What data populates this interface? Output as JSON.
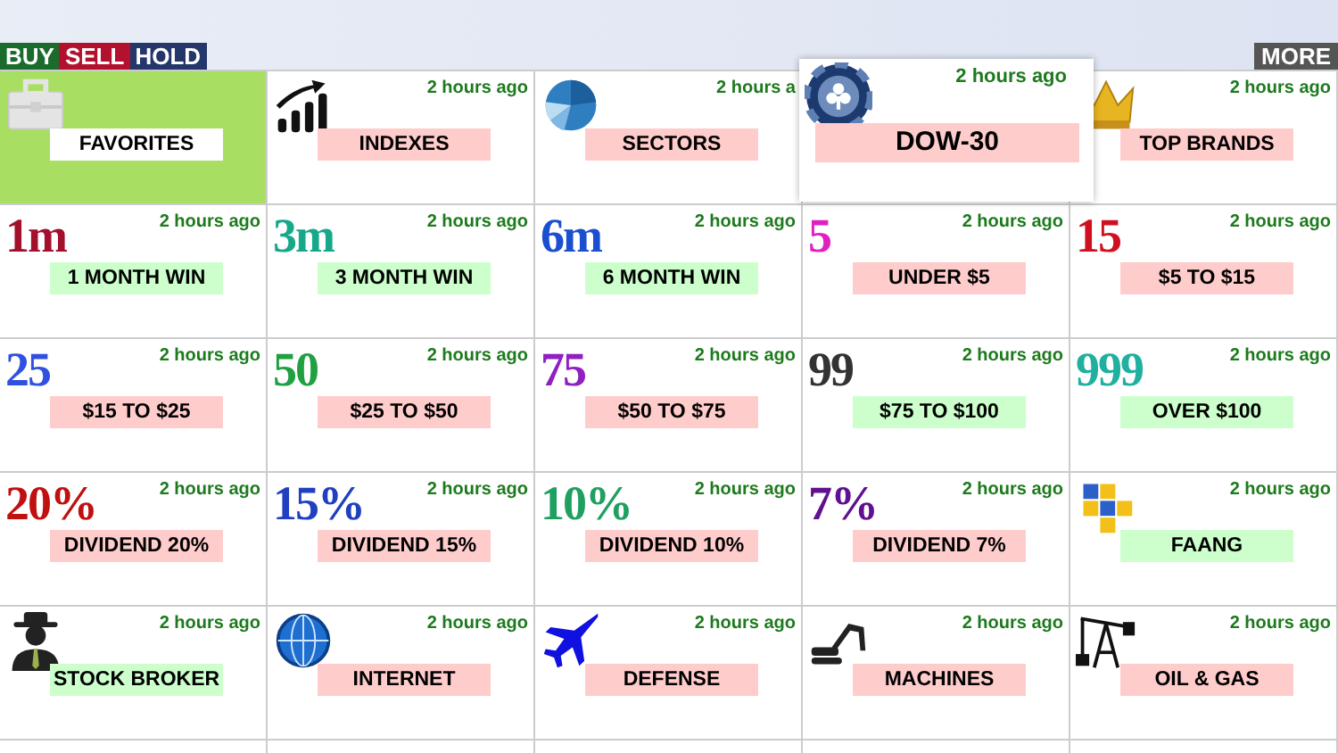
{
  "logo": [
    {
      "text": "BUY",
      "color": "#1b6b2c"
    },
    {
      "text": "SELL",
      "color": "#b3122e"
    },
    {
      "text": "HOLD",
      "color": "#24366a"
    }
  ],
  "more_button": "MORE",
  "tiles": [
    {
      "label": "FAVORITES",
      "kind": "briefcase",
      "color": "#ffffff",
      "selected": true,
      "raised": false
    },
    {
      "label": "INDEXES",
      "time": "2 hours ago",
      "kind": "growth-chart",
      "color": "#ffcccc",
      "selected": false,
      "raised": false
    },
    {
      "label": "SECTORS",
      "time": "2 hours a",
      "kind": "pie-chart",
      "color": "#ffcccc",
      "selected": false,
      "raised": false
    },
    {
      "label": "DOW-30",
      "time": "2 hours ago",
      "kind": "chip",
      "color": "#ffcccc",
      "selected": false,
      "raised": true
    },
    {
      "label": "TOP BRANDS",
      "time": "2 hours ago",
      "kind": "crown",
      "color": "#ffcccc",
      "selected": false,
      "raised": false
    },
    {
      "label": "1 MONTH WIN",
      "time": "2 hours ago",
      "kind": "glyph",
      "glyph": {
        "text": "1m",
        "color": "#a3102c"
      },
      "color": "#ccffcc",
      "selected": false,
      "raised": false
    },
    {
      "label": "3 MONTH WIN",
      "time": "2 hours ago",
      "kind": "glyph",
      "glyph": {
        "text": "3m",
        "color": "#17a88a"
      },
      "color": "#ccffcc",
      "selected": false,
      "raised": false
    },
    {
      "label": "6 MONTH WIN",
      "time": "2 hours ago",
      "kind": "glyph",
      "glyph": {
        "text": "6m",
        "color": "#1a4fd0"
      },
      "color": "#ccffcc",
      "selected": false,
      "raised": false
    },
    {
      "label": "UNDER $5",
      "time": "2 hours ago",
      "kind": "glyph",
      "glyph": {
        "text": "5",
        "color": "#e020c0"
      },
      "color": "#ffcccc",
      "selected": false,
      "raised": false
    },
    {
      "label": "$5 TO $15",
      "time": "2 hours ago",
      "kind": "glyph",
      "glyph": {
        "text": "15",
        "color": "#d01020"
      },
      "color": "#ffcccc",
      "selected": false,
      "raised": false
    },
    {
      "label": "$15 TO $25",
      "time": "2 hours ago",
      "kind": "glyph",
      "glyph": {
        "text": "25",
        "color": "#3050e0"
      },
      "color": "#ffcccc",
      "selected": false,
      "raised": false
    },
    {
      "label": "$25 TO $50",
      "time": "2 hours ago",
      "kind": "glyph",
      "glyph": {
        "text": "50",
        "color": "#20a040"
      },
      "color": "#ffcccc",
      "selected": false,
      "raised": false
    },
    {
      "label": "$50 TO $75",
      "time": "2 hours ago",
      "kind": "glyph",
      "glyph": {
        "text": "75",
        "color": "#9020c0"
      },
      "color": "#ffcccc",
      "selected": false,
      "raised": false
    },
    {
      "label": "$75 TO $100",
      "time": "2 hours ago",
      "kind": "glyph",
      "glyph": {
        "text": "99",
        "color": "#333333"
      },
      "color": "#ccffcc",
      "selected": false,
      "raised": false
    },
    {
      "label": "OVER $100",
      "time": "2 hours ago",
      "kind": "glyph",
      "glyph": {
        "text": "999",
        "color": "#20b0a0"
      },
      "color": "#ccffcc",
      "selected": false,
      "raised": false
    },
    {
      "label": "DIVIDEND 20%",
      "time": "2 hours ago",
      "kind": "glyph",
      "glyph": {
        "text": "20%",
        "color": "#c01010"
      },
      "color": "#ffcccc",
      "selected": false,
      "raised": false
    },
    {
      "label": "DIVIDEND 15%",
      "time": "2 hours ago",
      "kind": "glyph",
      "glyph": {
        "text": "15%",
        "color": "#2040c0"
      },
      "color": "#ffcccc",
      "selected": false,
      "raised": false
    },
    {
      "label": "DIVIDEND 10%",
      "time": "2 hours ago",
      "kind": "glyph",
      "glyph": {
        "text": "10%",
        "color": "#20a060"
      },
      "color": "#ffcccc",
      "selected": false,
      "raised": false
    },
    {
      "label": "DIVIDEND 7%",
      "time": "2 hours ago",
      "kind": "glyph",
      "glyph": {
        "text": "7%",
        "color": "#601090"
      },
      "color": "#ffcccc",
      "selected": false,
      "raised": false
    },
    {
      "label": "FAANG",
      "time": "2 hours ago",
      "kind": "cubes",
      "color": "#ccffcc",
      "selected": false,
      "raised": false
    },
    {
      "label": "STOCK BROKER",
      "time": "2 hours ago",
      "kind": "person",
      "color": "#ccffcc",
      "selected": false,
      "raised": false
    },
    {
      "label": "INTERNET",
      "time": "2 hours ago",
      "kind": "globe",
      "color": "#ffcccc",
      "selected": false,
      "raised": false
    },
    {
      "label": "DEFENSE",
      "time": "2 hours ago",
      "kind": "jet",
      "color": "#ffcccc",
      "selected": false,
      "raised": false
    },
    {
      "label": "MACHINES",
      "time": "2 hours ago",
      "kind": "excavator",
      "color": "#ffcccc",
      "selected": false,
      "raised": false
    },
    {
      "label": "OIL & GAS",
      "time": "2 hours ago",
      "kind": "oil-pump",
      "color": "#ffcccc",
      "selected": false,
      "raised": false
    }
  ]
}
